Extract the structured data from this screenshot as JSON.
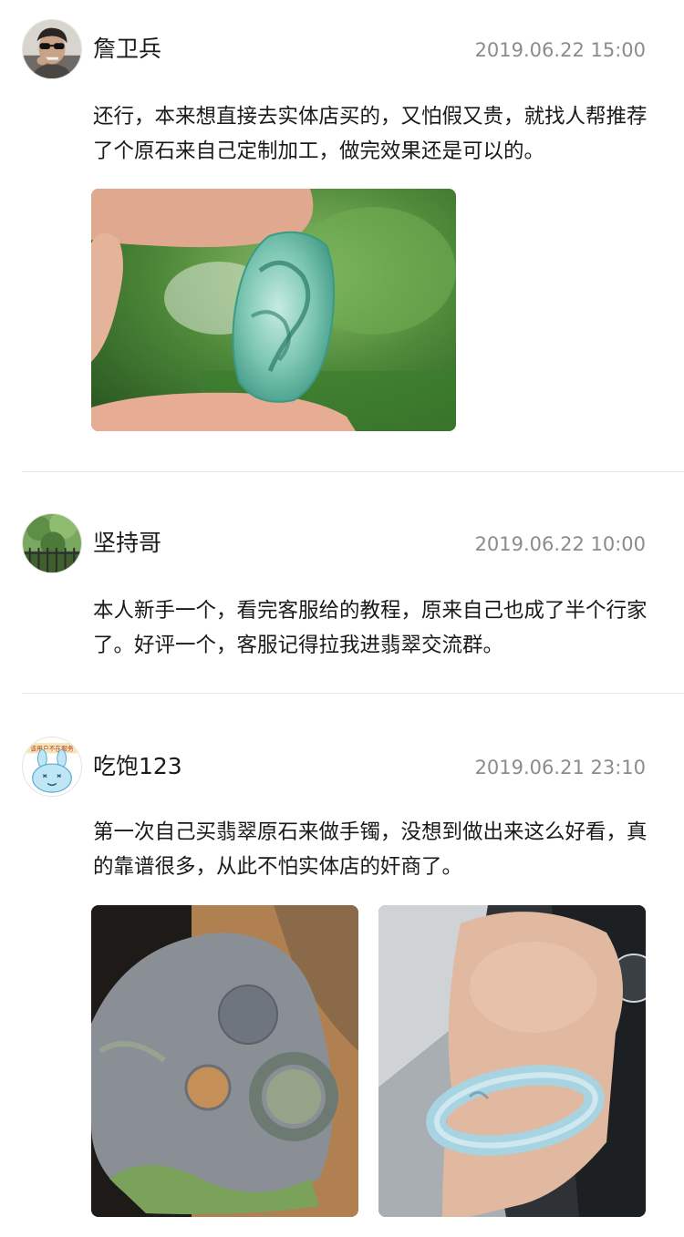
{
  "reviews": [
    {
      "username": "詹卫兵",
      "timestamp": "2019.06.22 15:00",
      "content": "还行，本来想直接去实体店买的，又怕假又贵，就找人帮推荐了个原石来自己定制加工，做完效果还是可以的。",
      "avatar_icon": "man-with-sunglasses-avatar",
      "photos": [
        "jade-pendant-photo"
      ]
    },
    {
      "username": "坚持哥",
      "timestamp": "2019.06.22 10:00",
      "content": "本人新手一个，看完客服给的教程，原来自己也成了半个行家了。好评一个，客服记得拉我进翡翠交流群。",
      "avatar_icon": "green-plants-avatar",
      "photos": []
    },
    {
      "username": "吃饱123",
      "timestamp": "2019.06.21 23:10",
      "content": "第一次自己买翡翠原石来做手镯，没想到做出来这么好看，真的靠谱很多，从此不怕实体店的奸商了。",
      "avatar_icon": "cartoon-rabbit-avatar",
      "avatar_text": "该用户不在服务",
      "photos": [
        "jade-raw-stone-photo",
        "jade-bracelet-on-wrist-photo"
      ]
    }
  ]
}
